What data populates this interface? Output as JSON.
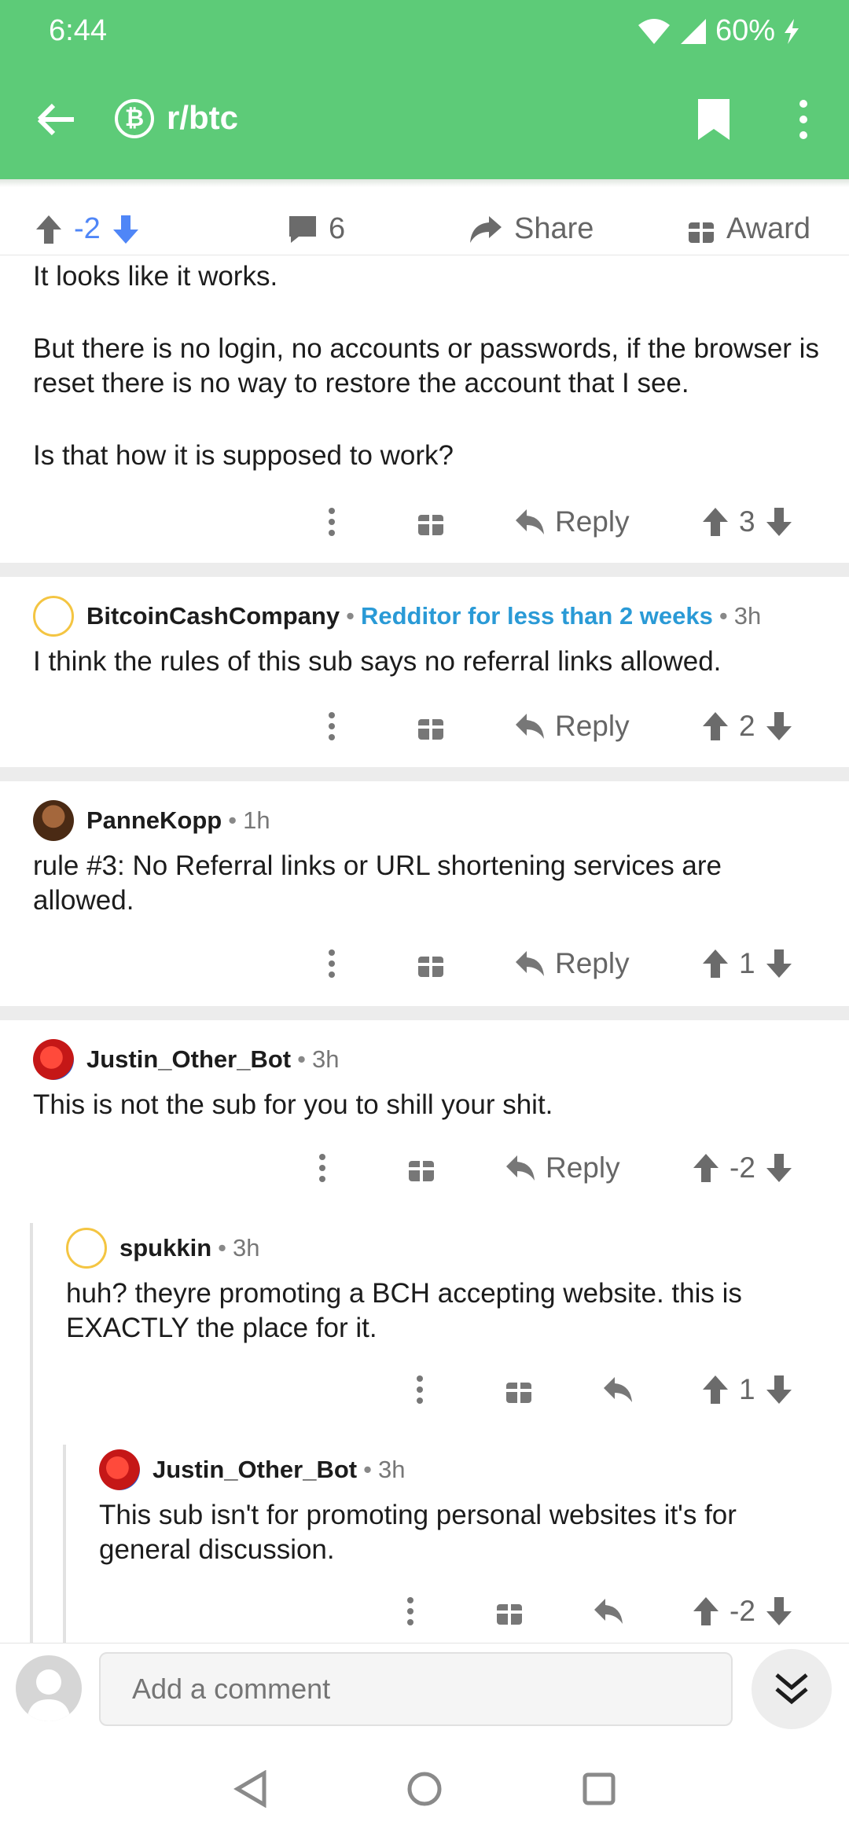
{
  "status": {
    "time": "6:44",
    "battery": "60%"
  },
  "toolbar": {
    "subreddit": "r/btc",
    "sub_icon": "bitcoin-icon"
  },
  "post_actions": {
    "score": "-2",
    "comments": "6",
    "share": "Share",
    "award": "Award"
  },
  "comment_top": {
    "line1": "It looks like it works.",
    "line2": "But there is no login, no accounts or passwords, if the browser is reset there is no way to restore the account that I see.",
    "line3": "Is that how it is supposed to work?",
    "reply": "Reply",
    "score": "3"
  },
  "comment2": {
    "user": "BitcoinCashCompany",
    "flair": "Redditor for less than 2 weeks",
    "age": "3h",
    "text": "I think the rules of this sub says no referral links allowed.",
    "reply": "Reply",
    "score": "2"
  },
  "comment3": {
    "user": "PanneKopp",
    "age": "1h",
    "text": "rule #3:  No Referral links or URL shortening services are allowed.",
    "reply": "Reply",
    "score": "1"
  },
  "comment4": {
    "user": "Justin_Other_Bot",
    "age": "3h",
    "text": "This is not the sub for you to shill your shit.",
    "reply": "Reply",
    "score": "-2"
  },
  "comment5": {
    "user": "spukkin",
    "age": "3h",
    "text": "huh? theyre promoting a BCH accepting website. this is EXACTLY the place for it.",
    "score": "1"
  },
  "comment6": {
    "user": "Justin_Other_Bot",
    "age": "3h",
    "text": "This sub isn't for promoting personal websites it's for general discussion.",
    "score": "-2"
  },
  "composer": {
    "placeholder": "Add a comment"
  },
  "colors": {
    "header": "#5dcb78",
    "flair": "#2a9ad6",
    "vote_blue": "#4f86f7"
  }
}
